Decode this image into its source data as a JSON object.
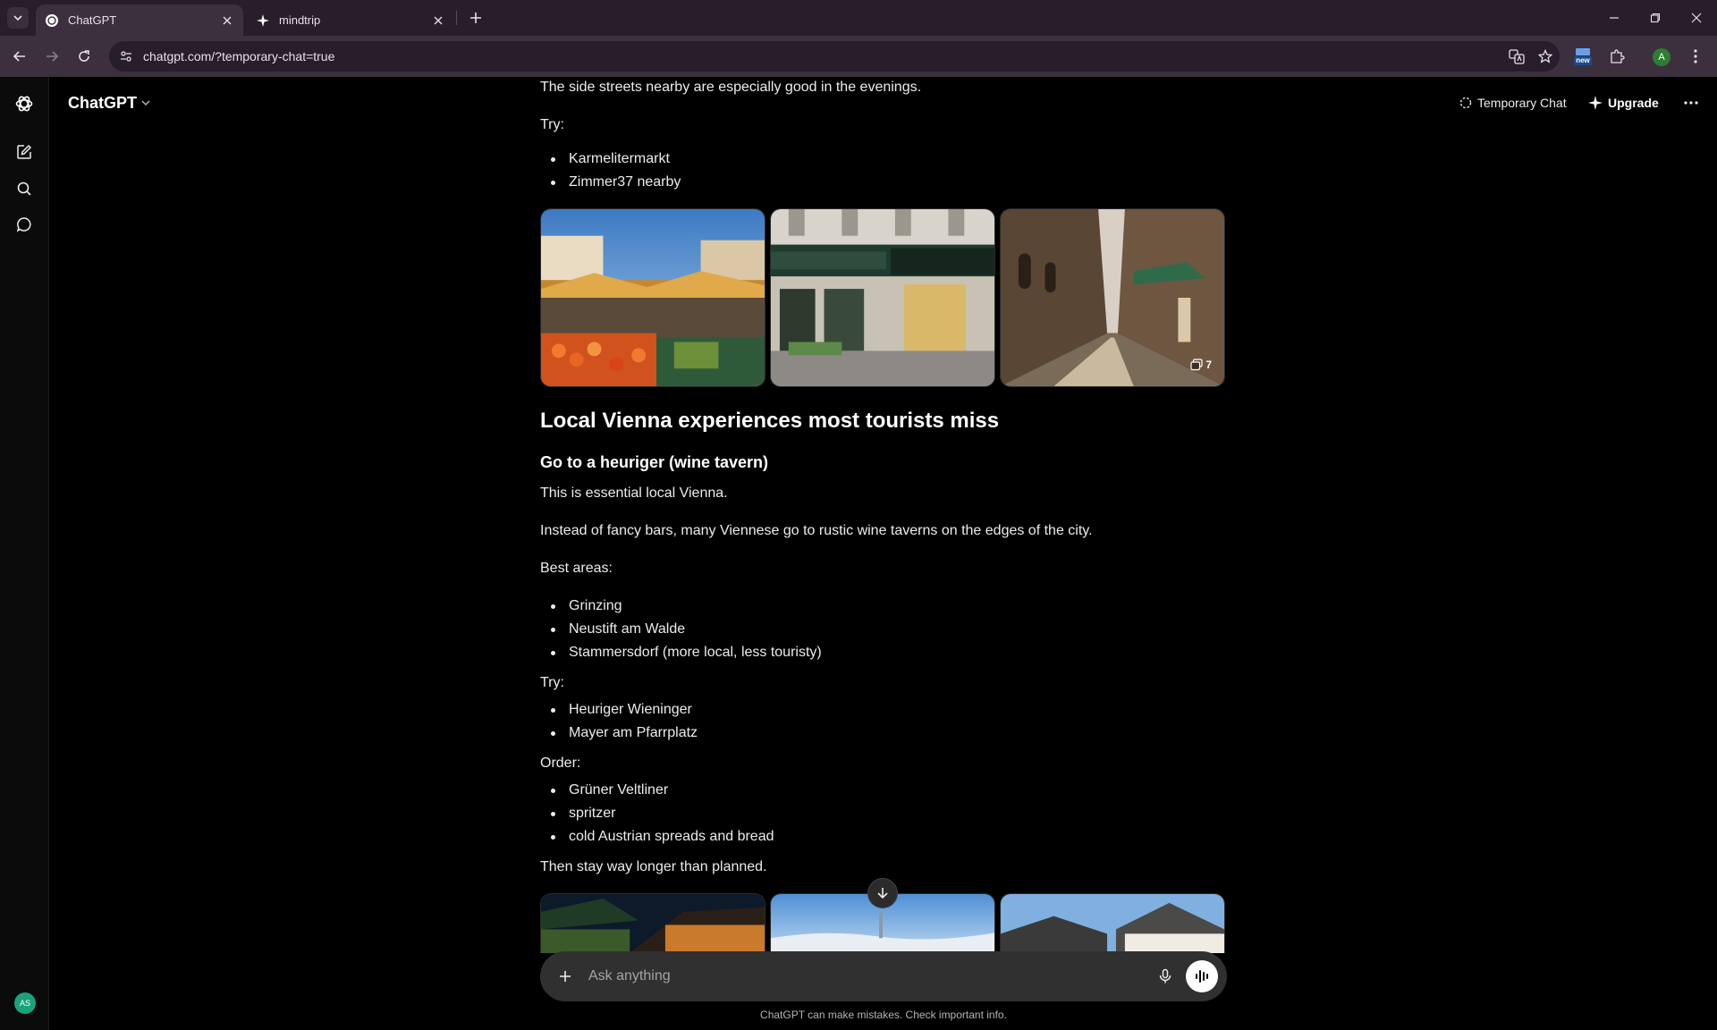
{
  "browser": {
    "tabs": [
      {
        "title": "ChatGPT",
        "active": true
      },
      {
        "title": "mindtrip",
        "active": false
      }
    ],
    "url": "chatgpt.com/?temporary-chat=true",
    "extension_badge": "new",
    "profile_initial": "A"
  },
  "app": {
    "model_name": "ChatGPT",
    "temporary_chat_label": "Temporary Chat",
    "upgrade_label": "Upgrade",
    "user_initials": "AS"
  },
  "message": {
    "intro_line": "The side streets nearby are especially good in the evenings.",
    "try_label_1": "Try:",
    "try_items_1": [
      "Karmelitermarkt",
      "Zimmer37 nearby"
    ],
    "gallery_1_count": "7",
    "section_heading": "Local Vienna experiences most tourists miss",
    "sub_heading": "Go to a heuriger (wine tavern)",
    "para_1": "This is essential local Vienna.",
    "para_2": "Instead of fancy bars, many Viennese go to rustic wine taverns on the edges of the city.",
    "best_areas_label": "Best areas:",
    "best_areas": [
      "Grinzing",
      "Neustift am Walde",
      "Stammersdorf (more local, less touristy)"
    ],
    "try_label_2": "Try:",
    "try_items_2": [
      "Heuriger Wieninger",
      "Mayer am Pfarrplatz"
    ],
    "order_label": "Order:",
    "order_items": [
      "Grüner Veltliner",
      "spritzer",
      "cold Austrian spreads and bread"
    ],
    "closing_line": "Then stay way longer than planned."
  },
  "composer": {
    "placeholder": "Ask anything",
    "disclaimer": "ChatGPT can make mistakes. Check important info."
  },
  "colors": {
    "tabbar_bg": "#281d2a",
    "toolbar_bg": "#3c2f3e",
    "app_bg": "#000000",
    "composer_bg": "#303030",
    "text": "#ececec"
  }
}
